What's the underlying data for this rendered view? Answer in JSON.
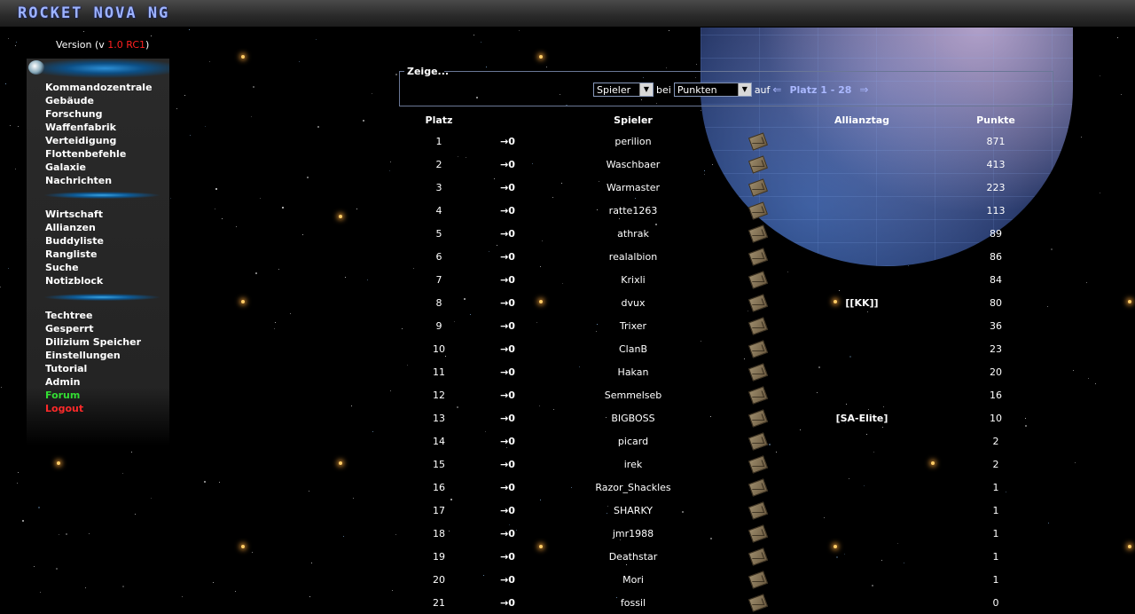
{
  "header": {
    "logo": "ROCKET NOVA NG"
  },
  "version": {
    "prefix": "Version (v ",
    "number": "1.0 RC1",
    "suffix": ")"
  },
  "colors": {
    "accent": "#aab8ff",
    "forum": "#33dd33",
    "logout": "#ff2a2a",
    "version_number": "#ff2020"
  },
  "sidebar": {
    "group1": [
      "Kommandozentrale",
      "Gebäude",
      "Forschung",
      "Waffenfabrik",
      "Verteidigung",
      "Flottenbefehle",
      "Galaxie",
      "Nachrichten"
    ],
    "group2": [
      "Wirtschaft",
      "Allianzen",
      "Buddyliste",
      "Rangliste",
      "Suche",
      "Notizblock"
    ],
    "group3": [
      "Techtree",
      "Gesperrt",
      "Dilizium Speicher",
      "Einstellungen",
      "Tutorial",
      "Admin",
      "Forum",
      "Logout"
    ]
  },
  "filter": {
    "legend": "Zeige...",
    "type_value": "Spieler",
    "bei": "bei",
    "sort_value": "Punkten",
    "auf": "auf",
    "prev_arrow": "⇐",
    "range": "Platz 1 - 28",
    "next_arrow": "⇒"
  },
  "table": {
    "headers": {
      "platz": "Platz",
      "spieler": "Spieler",
      "allianztag": "Allianztag",
      "punkte": "Punkte"
    },
    "rows": [
      {
        "platz": "1",
        "change": "→0",
        "spieler": "perilion",
        "ally": "",
        "punkte": "871"
      },
      {
        "platz": "2",
        "change": "→0",
        "spieler": "Waschbaer",
        "ally": "",
        "punkte": "413"
      },
      {
        "platz": "3",
        "change": "→0",
        "spieler": "Warmaster",
        "ally": "",
        "punkte": "223"
      },
      {
        "platz": "4",
        "change": "→0",
        "spieler": "ratte1263",
        "ally": "",
        "punkte": "113"
      },
      {
        "platz": "5",
        "change": "→0",
        "spieler": "athrak",
        "ally": "",
        "punkte": "89"
      },
      {
        "platz": "6",
        "change": "→0",
        "spieler": "realalbion",
        "ally": "",
        "punkte": "86"
      },
      {
        "platz": "7",
        "change": "→0",
        "spieler": "Krixli",
        "ally": "",
        "punkte": "84"
      },
      {
        "platz": "8",
        "change": "→0",
        "spieler": "dvux",
        "ally": "[[KK]]",
        "punkte": "80"
      },
      {
        "platz": "9",
        "change": "→0",
        "spieler": "Trixer",
        "ally": "",
        "punkte": "36"
      },
      {
        "platz": "10",
        "change": "→0",
        "spieler": "ClanB",
        "ally": "",
        "punkte": "23"
      },
      {
        "platz": "11",
        "change": "→0",
        "spieler": "Hakan",
        "ally": "",
        "punkte": "20"
      },
      {
        "platz": "12",
        "change": "→0",
        "spieler": "Semmelseb",
        "ally": "",
        "punkte": "16"
      },
      {
        "platz": "13",
        "change": "→0",
        "spieler": "BIGBOSS",
        "ally": "[SA-Elite]",
        "punkte": "10"
      },
      {
        "platz": "14",
        "change": "→0",
        "spieler": "picard",
        "ally": "",
        "punkte": "2"
      },
      {
        "platz": "15",
        "change": "→0",
        "spieler": "irek",
        "ally": "",
        "punkte": "2"
      },
      {
        "platz": "16",
        "change": "→0",
        "spieler": "Razor_Shackles",
        "ally": "",
        "punkte": "1"
      },
      {
        "platz": "17",
        "change": "→0",
        "spieler": "SHARKY",
        "ally": "",
        "punkte": "1"
      },
      {
        "platz": "18",
        "change": "→0",
        "spieler": "jmr1988",
        "ally": "",
        "punkte": "1"
      },
      {
        "platz": "19",
        "change": "→0",
        "spieler": "Deathstar",
        "ally": "",
        "punkte": "1"
      },
      {
        "platz": "20",
        "change": "→0",
        "spieler": "Mori",
        "ally": "",
        "punkte": "1"
      },
      {
        "platz": "21",
        "change": "→0",
        "spieler": "fossil",
        "ally": "",
        "punkte": "0"
      }
    ]
  }
}
